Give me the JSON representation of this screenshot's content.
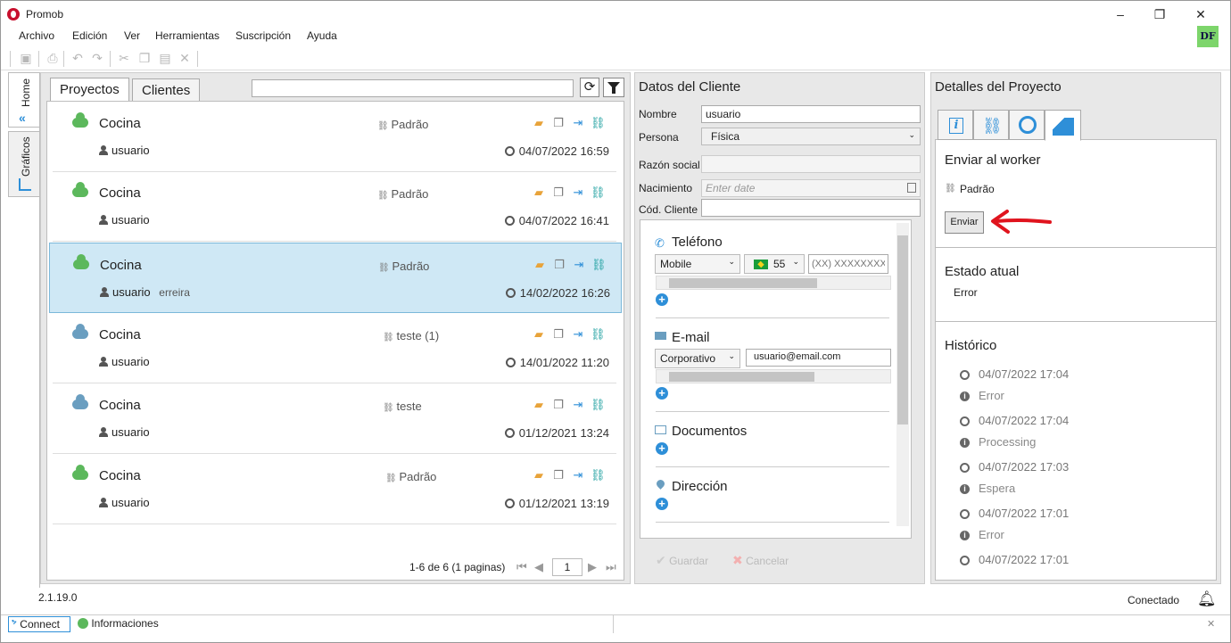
{
  "window": {
    "title": "Promob",
    "user_badge": "DF",
    "controls": {
      "minimize": "–",
      "restore": "❐",
      "close": "✕"
    }
  },
  "menu": [
    "Archivo",
    "Edición",
    "Ver",
    "Herramientas",
    "Suscripción",
    "Ayuda"
  ],
  "toolbar": {
    "icons": [
      "save-icon",
      "print-icon",
      "undo-icon",
      "redo-icon",
      "cut-icon",
      "copy-icon",
      "paste-icon",
      "delete-icon"
    ]
  },
  "sidebar": {
    "tabs": [
      {
        "label": "Home",
        "icon": "home-chevron-icon"
      },
      {
        "label": "Gráficos",
        "icon": "chart-icon"
      }
    ]
  },
  "projects": {
    "tabs": [
      "Proyectos",
      "Clientes"
    ],
    "search_value": "",
    "rows": [
      {
        "name": "Cocina",
        "user": "usuario",
        "extra": "",
        "version": "Padrão",
        "date": "04/07/2022 16:59",
        "cloud_color": "#5cb85c"
      },
      {
        "name": "Cocina",
        "user": "usuario",
        "extra": "",
        "version": "Padrão",
        "date": "04/07/2022 16:41",
        "cloud_color": "#5cb85c"
      },
      {
        "name": "Cocina",
        "user": "usuario",
        "extra": "erreira",
        "version": "Padrão",
        "date": "14/02/2022 16:26",
        "cloud_color": "#5cb85c"
      },
      {
        "name": "Cocina",
        "user": "usuario",
        "extra": "",
        "version": "teste (1)",
        "date": "14/01/2022 11:20",
        "cloud_color": "#6a9ec0"
      },
      {
        "name": "Cocina",
        "user": "usuario",
        "extra": "",
        "version": "teste",
        "date": "01/12/2021 13:24",
        "cloud_color": "#6a9ec0"
      },
      {
        "name": "Cocina",
        "user": "usuario",
        "extra": "",
        "version": "Padrão",
        "date": "01/12/2021 13:19",
        "cloud_color": "#5cb85c"
      }
    ],
    "pagination": {
      "summary": "1-6 de 6 (1 paginas)",
      "page": "1"
    }
  },
  "client": {
    "title": "Datos del Cliente",
    "labels": {
      "nombre": "Nombre",
      "persona": "Persona",
      "razon": "Razón social",
      "nacimiento": "Nacimiento",
      "codigo": "Cód. Cliente"
    },
    "nombre_value": "usuario",
    "persona_value": "Física",
    "razon_value": "",
    "nacimiento_placeholder": "Enter date",
    "codigo_value": "",
    "telefono": {
      "title": "Teléfono",
      "type": "Mobile",
      "country_code": "55",
      "number_placeholder": "(XX) XXXXXXXXX"
    },
    "email": {
      "title": "E-mail",
      "type": "Corporativo",
      "value": "usuario@email.com"
    },
    "documentos": {
      "title": "Documentos"
    },
    "direccion": {
      "title": "Dirección"
    },
    "buttons": {
      "save": "Guardar",
      "cancel": "Cancelar"
    }
  },
  "details": {
    "title": "Detalles del Proyecto",
    "tabs": [
      "info-icon",
      "structure-icon",
      "history-icon",
      "factory-icon"
    ],
    "worker": {
      "title": "Enviar al worker",
      "version": "Padrão",
      "send_button": "Enviar"
    },
    "state": {
      "title": "Estado atual",
      "value": "Error"
    },
    "history": {
      "title": "Histórico",
      "entries": [
        {
          "date": "04/07/2022 17:04",
          "status": "Error"
        },
        {
          "date": "04/07/2022 17:04",
          "status": "Processing"
        },
        {
          "date": "04/07/2022 17:03",
          "status": "Espera"
        },
        {
          "date": "04/07/2022 17:01",
          "status": "Error"
        },
        {
          "date": "04/07/2022 17:01",
          "status": ""
        }
      ]
    }
  },
  "footer": {
    "version": "2.1.19.0",
    "status": "Conectado",
    "bottom_tabs": [
      "Connect",
      "Informaciones"
    ]
  },
  "colors": {
    "accent_blue": "#2e8fd8",
    "selected_row": "#cfe8f5",
    "cloud_green": "#5cb85c",
    "cloud_blue": "#6a9ec0",
    "badge_green": "#7dd56b",
    "arrow_red": "#e0141e"
  }
}
